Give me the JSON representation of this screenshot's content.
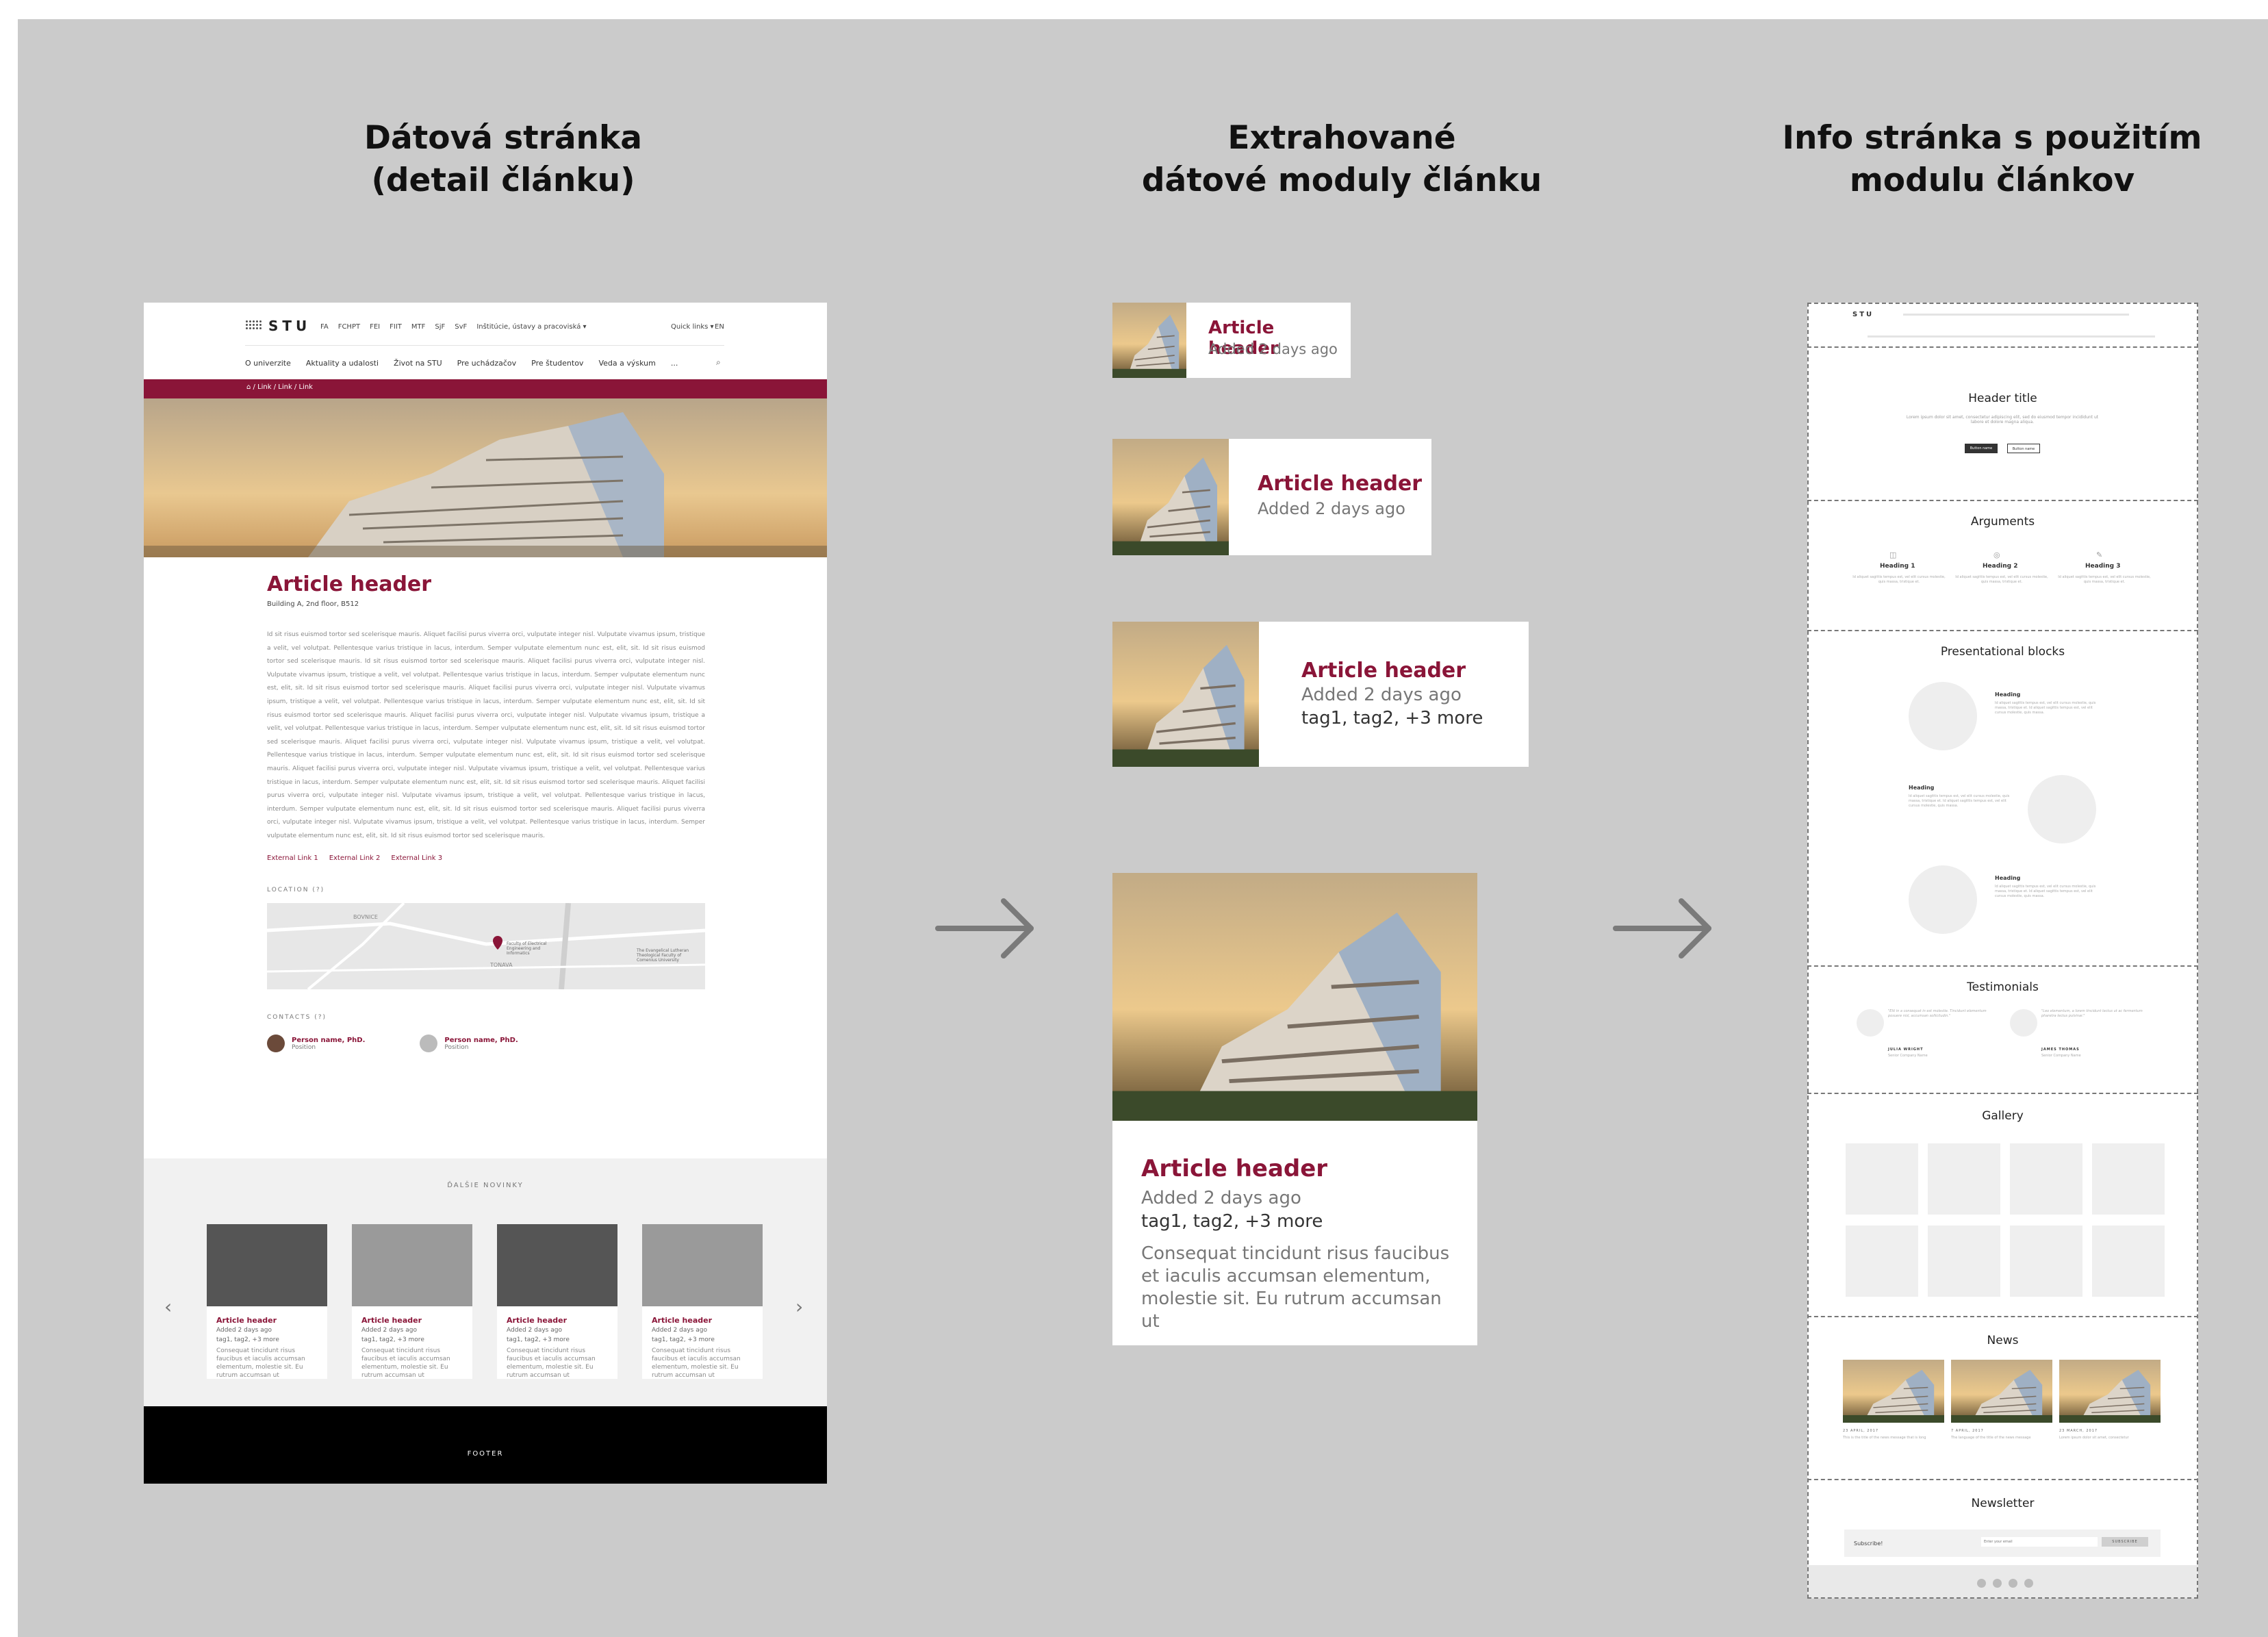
{
  "columns": {
    "left_title": "Dátová stránka\n(detail článku)",
    "middle_title": "Extrahované\ndátové moduly článku",
    "right_title": "Info stránka s použitím\nmodulu článkov"
  },
  "left_page": {
    "logo": "STU",
    "top_nav": [
      "FA",
      "FCHPT",
      "FEI",
      "FIIT",
      "MTF",
      "SjF",
      "SvF",
      "Inštitúcie, ústavy a pracoviská ▾"
    ],
    "quick_links": "Quick links ▾",
    "lang": "EN",
    "main_nav": [
      "O univerzite",
      "Aktuality a udalosti",
      "Život na STU",
      "Pre uchádzačov",
      "Pre študentov",
      "Veda a výskum",
      "..."
    ],
    "breadcrumb": "⌂  /  Link  /  Link  /  Link",
    "article_title": "Article header",
    "article_location": "Building A, 2nd floor, B512",
    "article_text": "Id sit risus euismod tortor sed scelerisque mauris. Aliquet facilisi purus viverra orci, vulputate integer nisl. Vulputate vivamus ipsum, tristique a velit, vel volutpat. Pellentesque varius tristique in lacus, interdum. Semper vulputate elementum nunc est, elit, sit. Id sit risus euismod tortor sed scelerisque mauris. Id sit risus euismod tortor sed scelerisque mauris. Aliquet facilisi purus viverra orci, vulputate integer nisl. Vulputate vivamus ipsum, tristique a velit, vel volutpat. Pellentesque varius tristique in lacus, interdum. Semper vulputate elementum nunc est, elit, sit. Id sit risus euismod tortor sed scelerisque mauris. Aliquet facilisi purus viverra orci, vulputate integer nisl. Vulputate vivamus ipsum, tristique a velit, vel volutpat. Pellentesque varius tristique in lacus, interdum. Semper vulputate elementum nunc est, elit, sit. Id sit risus euismod tortor sed scelerisque mauris. Aliquet facilisi purus viverra orci, vulputate integer nisl. Vulputate vivamus ipsum, tristique a velit, vel volutpat. Pellentesque varius tristique in lacus, interdum. Semper vulputate elementum nunc est, elit, sit. Id sit risus euismod tortor sed scelerisque mauris. Aliquet facilisi purus viverra orci, vulputate integer nisl. Vulputate vivamus ipsum, tristique a velit, vel volutpat. Pellentesque varius tristique in lacus, interdum. Semper vulputate elementum nunc est, elit, sit. Id sit risus euismod tortor sed scelerisque mauris. Aliquet facilisi purus viverra orci, vulputate integer nisl. Vulputate vivamus ipsum, tristique a velit, vel volutpat. Pellentesque varius tristique in lacus, interdum. Semper vulputate elementum nunc est, elit, sit. Id sit risus euismod tortor sed scelerisque mauris. Aliquet facilisi purus viverra orci, vulputate integer nisl. Vulputate vivamus ipsum, tristique a velit, vel volutpat. Pellentesque varius tristique in lacus, interdum. Semper vulputate elementum nunc est, elit, sit. Id sit risus euismod tortor sed scelerisque mauris. Aliquet facilisi purus viverra orci, vulputate integer nisl. Vulputate vivamus ipsum, tristique a velit, vel volutpat. Pellentesque varius tristique in lacus, interdum. Semper vulputate elementum nunc est, elit, sit. Id sit risus euismod tortor sed scelerisque mauris.",
    "external_links": [
      "External Link 1",
      "External Link 2",
      "External Link 3"
    ],
    "location_label": "LOCATION (?)",
    "map_labels": [
      "BOVNICE",
      "TONAVA",
      "Faculty of Electrical Engineering and Informatics",
      "The Evangelical Lutheran Theological Faculty of Comenius University"
    ],
    "contacts_label": "CONTACTS (?)",
    "contacts": [
      {
        "name": "Person name, PhD.",
        "position": "Position"
      },
      {
        "name": "Person name, PhD.",
        "position": "Position"
      }
    ],
    "news_label": "ĎALŠIE NOVINKY",
    "news_cards": [
      {
        "title": "Article header",
        "meta": "Added 2 days ago",
        "tags": "tag1, tag2, +3 more",
        "excerpt": "Consequat tincidunt risus faucibus et iaculis accumsan elementum, molestie sit. Eu rutrum accumsan ut"
      },
      {
        "title": "Article header",
        "meta": "Added 2 days ago",
        "tags": "tag1, tag2, +3 more",
        "excerpt": "Consequat tincidunt risus faucibus et iaculis accumsan elementum, molestie sit. Eu rutrum accumsan ut"
      },
      {
        "title": "Article header",
        "meta": "Added 2 days ago",
        "tags": "tag1, tag2, +3 more",
        "excerpt": "Consequat tincidunt risus faucibus et iaculis accumsan elementum, molestie sit. Eu rutrum accumsan ut"
      },
      {
        "title": "Article header",
        "meta": "Added 2 days ago",
        "tags": "tag1, tag2, +3 more",
        "excerpt": "Consequat tincidunt risus faucibus et iaculis accumsan elementum, molestie sit. Eu rutrum accumsan ut"
      }
    ],
    "footer": "FOOTER"
  },
  "modules": [
    {
      "title": "Article header",
      "meta": "Added 2 days ago"
    },
    {
      "title": "Article header",
      "meta": "Added 2 days ago"
    },
    {
      "title": "Article header",
      "meta": "Added 2 days ago",
      "tags": "tag1, tag2, +3 more"
    },
    {
      "title": "Article header",
      "meta": "Added 2 days ago",
      "tags": "tag1, tag2, +3 more",
      "excerpt": "Consequat tincidunt risus faucibus et iaculis accumsan elementum, molestie sit. Eu rutrum accumsan ut"
    }
  ],
  "right_page": {
    "logo": "STU",
    "header_title": "Header title",
    "header_desc": "Lorem ipsum dolor sit amet, consectetur adipiscing elit, sed do eiusmod tempor incididunt ut labore et dolore magna aliqua.",
    "header_btn_primary": "Button name",
    "header_btn_secondary": "Button name",
    "arguments_title": "Arguments",
    "arguments": [
      {
        "heading": "Heading 1",
        "text": "Id aliquet sagittis tempus est, vel elit cursus molestie, quis massa, tristique et."
      },
      {
        "heading": "Heading 2",
        "text": "Id aliquet sagittis tempus est, vel elit cursus molestie, quis massa, tristique et."
      },
      {
        "heading": "Heading 3",
        "text": "Id aliquet sagittis tempus est, vel elit cursus molestie, quis massa, tristique et."
      }
    ],
    "blocks_title": "Presentational blocks",
    "blocks": [
      {
        "heading": "Heading",
        "text": "Id aliquet sagittis tempus est, vel elit cursus molestie, quis massa, tristique et. Id aliquet sagittis tempus est, vel elit cursus molestie, quis massa."
      },
      {
        "heading": "Heading",
        "text": "Id aliquet sagittis tempus est, vel elit cursus molestie, quis massa, tristique et. Id aliquet sagittis tempus est, vel elit cursus molestie, quis massa."
      },
      {
        "heading": "Heading",
        "text": "Id aliquet sagittis tempus est, vel elit cursus molestie, quis massa, tristique et. Id aliquet sagittis tempus est, vel elit cursus molestie, quis massa."
      }
    ],
    "testimonials_title": "Testimonials",
    "testimonials": [
      {
        "quote": "\"Elit in a consequat in est molestie. Tincidunt elementum posuere nisl, accumsan sollicitudin.\"",
        "name": "JULIA WRIGHT",
        "role": "Senior Company Name"
      },
      {
        "quote": "\"Leo elementum, a lorem tincidunt lectus ut ac fermentum pharetra lectus pulvinar.\"",
        "name": "JAMES THOMAS",
        "role": "Senior Company Name"
      }
    ],
    "gallery_title": "Gallery",
    "news_title": "News",
    "news": [
      {
        "date": "23 APRIL, 2017",
        "text": "This is the title of the news message that is long"
      },
      {
        "date": "7 APRIL, 2017",
        "text": "The language of the title of the news message"
      },
      {
        "date": "23 MARCH, 2017",
        "text": "Lorem ipsum dolor sit amet, consectetur"
      }
    ],
    "newsletter_title": "Newsletter",
    "subscribe_label": "Subscribe!",
    "email_placeholder": "Enter your email",
    "subscribe_button": "SUBSCRIBE"
  }
}
